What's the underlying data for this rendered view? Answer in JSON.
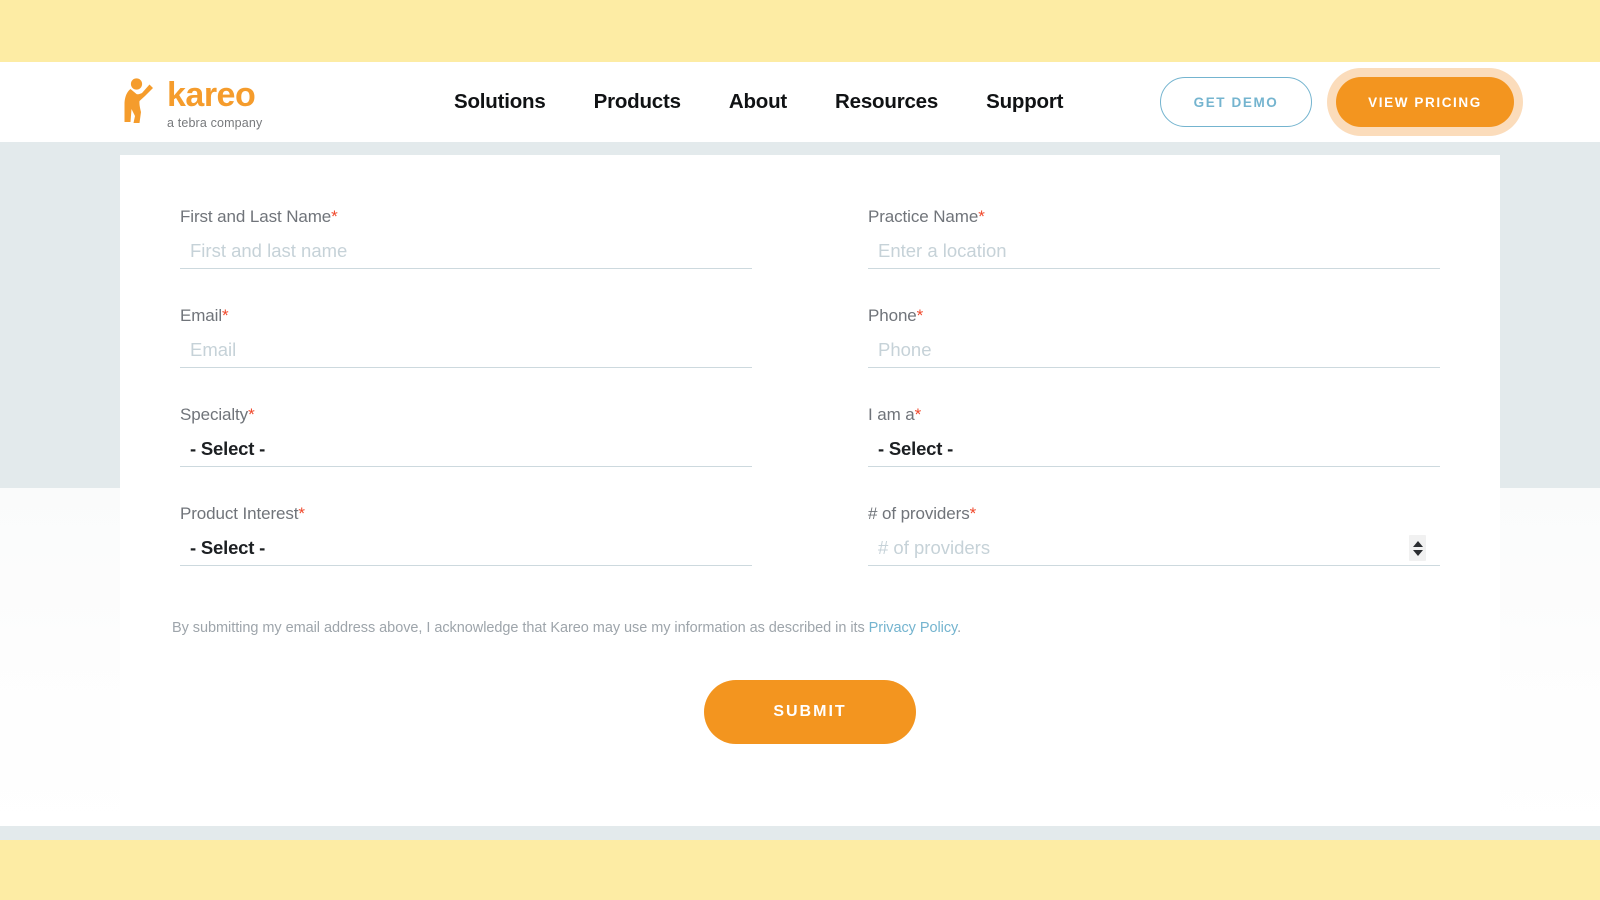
{
  "header": {
    "logo": {
      "word": "kareo",
      "tagline": "a tebra company",
      "mark_icon": "kareo-person-icon"
    },
    "nav": [
      {
        "label": "Solutions"
      },
      {
        "label": "Products"
      },
      {
        "label": "About"
      },
      {
        "label": "Resources"
      },
      {
        "label": "Support"
      }
    ],
    "actions": {
      "demo_label": "GET DEMO",
      "pricing_label": "VIEW PRICING"
    }
  },
  "form": {
    "fields": [
      {
        "id": "first-and-last-name",
        "label": "First and Last Name",
        "required": true,
        "type": "text",
        "placeholder": "First and last name",
        "value": ""
      },
      {
        "id": "practice-name",
        "label": "Practice Name",
        "required": true,
        "type": "text",
        "placeholder": "Enter a location",
        "value": ""
      },
      {
        "id": "email",
        "label": "Email",
        "required": true,
        "type": "text",
        "placeholder": "Email",
        "value": ""
      },
      {
        "id": "phone",
        "label": "Phone",
        "required": true,
        "type": "text",
        "placeholder": "Phone",
        "value": ""
      },
      {
        "id": "specialty",
        "label": "Specialty",
        "required": true,
        "type": "select",
        "selected": "- Select -"
      },
      {
        "id": "i-am-a",
        "label": "I am a",
        "required": true,
        "type": "select",
        "selected": "- Select -"
      },
      {
        "id": "product-interest",
        "label": "Product Interest",
        "required": true,
        "type": "select",
        "selected": "- Select -"
      },
      {
        "id": "number-of-providers",
        "label": "# of providers",
        "required": true,
        "type": "number",
        "placeholder": "# of providers",
        "value": "",
        "spinner_icon": "number-stepper-icon"
      }
    ],
    "required_marker": "*",
    "disclaimer": {
      "text_before": "By submitting my email address above, I acknowledge that Kareo may use my information as described in its ",
      "link_label": "Privacy Policy",
      "text_after": "."
    },
    "submit_label": "SUBMIT"
  },
  "colors": {
    "brand_orange": "#f3951f",
    "logo_orange": "#f59c2c",
    "accent_blue": "#74b4cf",
    "required_red": "#f0482b",
    "band_yellow": "#fdeca4",
    "section_gray": "#e3eaec",
    "underline": "#cdd9de",
    "placeholder": "#c6d2d8",
    "label_gray": "#70747a",
    "focus_halo": "#fbdcbb"
  }
}
